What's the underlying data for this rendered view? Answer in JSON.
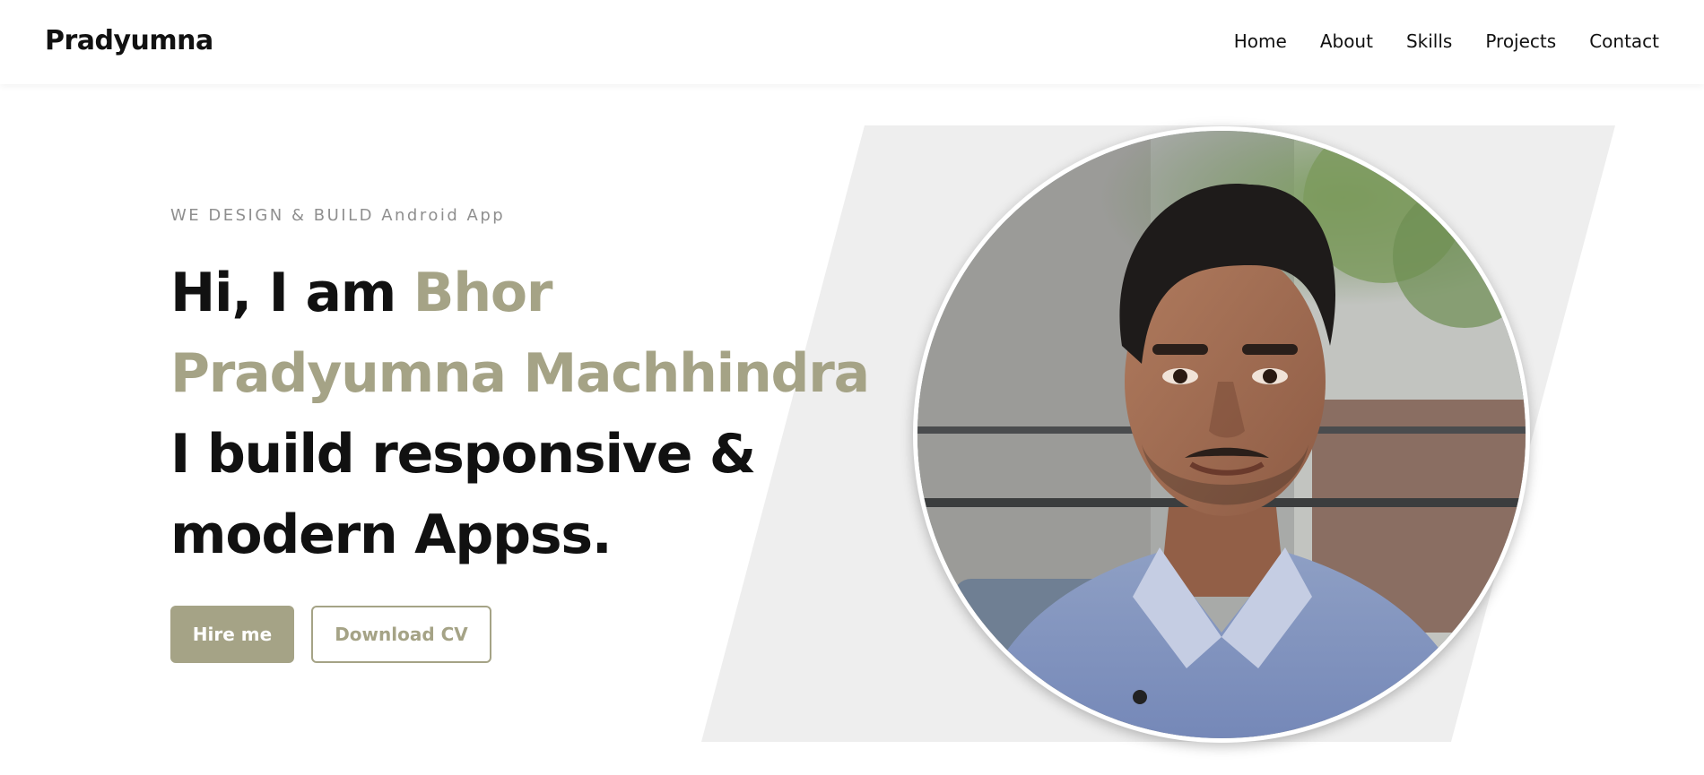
{
  "navbar": {
    "brand": "Pradyumna",
    "links": [
      "Home",
      "About",
      "Skills",
      "Projects",
      "Contact"
    ]
  },
  "hero": {
    "subtitle": "WE DESIGN & BUILD Android App",
    "greeting": "Hi, I am ",
    "name": "Bhor Pradyumna Machhindra",
    "tagline_line1": "I build responsive &",
    "tagline_line2": "modern Appss.",
    "hire_button": "Hire me",
    "cv_button": "Download CV"
  },
  "colors": {
    "accent": "#a5a386",
    "text": "#111111",
    "subtle": "#8f8f8f",
    "shape": "#eeeeee"
  }
}
